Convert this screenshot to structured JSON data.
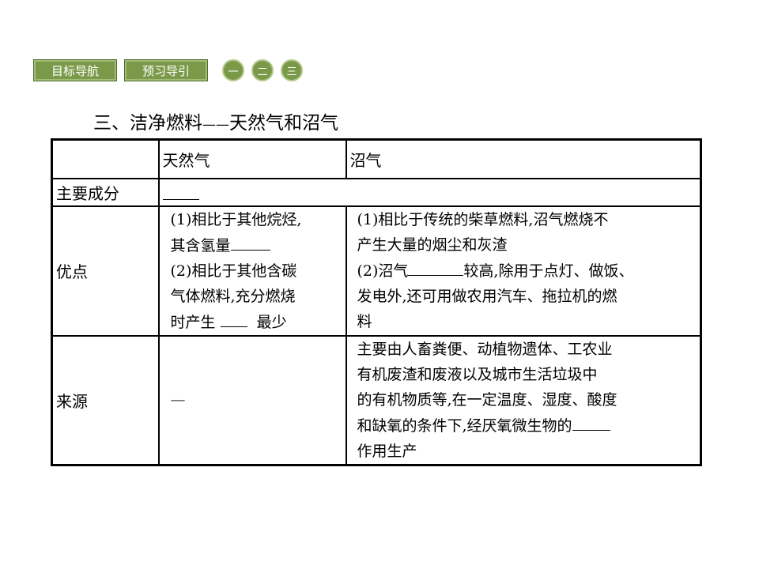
{
  "nav": {
    "buttons": [
      "目标导航",
      "预习导引"
    ],
    "sections": [
      "一",
      "二",
      "三"
    ]
  },
  "title": {
    "main": "三、洁净燃料",
    "dash": "——",
    "sub": "天然气和沼气"
  },
  "table": {
    "header": [
      "",
      "天然气",
      "沼气"
    ],
    "rows": {
      "component": {
        "label": "主要成分"
      },
      "advantage": {
        "label": "优点",
        "natural_gas": {
          "line1": "(1)相比于其他烷烃,",
          "line2_pre": "其含氢量",
          "line3": "(2)相比于其他含碳",
          "line4": "气体燃料,充分燃烧",
          "line5_pre": "时产生",
          "line5_post": "最少"
        },
        "biogas": {
          "line1": "(1)相比于传统的柴草燃料,沼气燃烧不",
          "line2": "产生大量的烟尘和灰渣",
          "line3_pre": "(2)沼气",
          "line3_post": "较高,除用于点灯、做饭、",
          "line4": "发电外,还可用做农用汽车、拖拉机的燃",
          "line5": "料"
        }
      },
      "source": {
        "label": "来源",
        "natural_gas": "—",
        "biogas": {
          "line1": "主要由人畜粪便、动植物遗体、工农业",
          "line2": "有机废渣和废液以及城市生活垃圾中",
          "line3": "的有机物质等,在一定温度、湿度、酸度",
          "line4_pre": "和缺氧的条件下,经厌氧微生物的",
          "line5": "作用生产"
        }
      }
    }
  },
  "colors": {
    "nav_green": "#7a9a4a"
  }
}
